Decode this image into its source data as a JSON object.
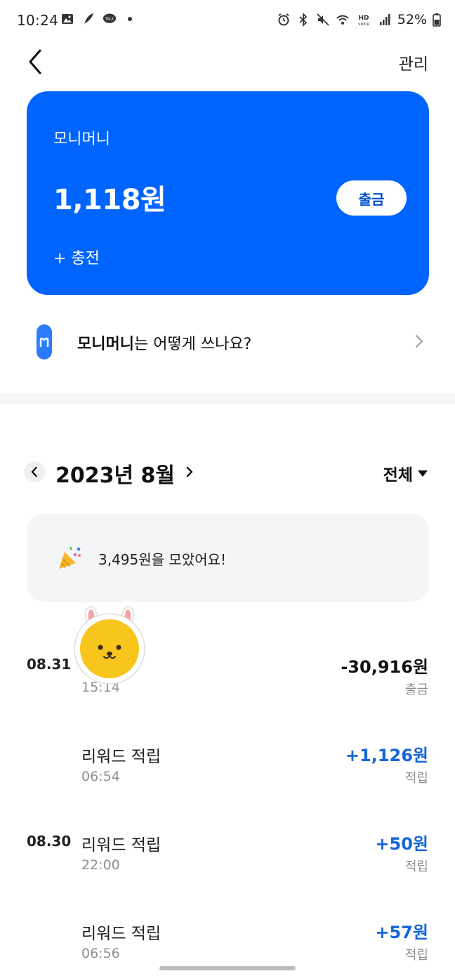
{
  "status_bar": {
    "time": "10:24",
    "battery": "52%"
  },
  "header": {
    "manage_label": "관리"
  },
  "wallet": {
    "name": "모니머니",
    "balance": "1,118원",
    "withdraw_label": "출금",
    "charge_label": "+ 충전",
    "accent_color": "#0064ff"
  },
  "guide": {
    "bold_part": "모니머니",
    "rest": "는 어떻게 쓰나요?"
  },
  "month_nav": {
    "title": "2023년 8월",
    "filter_label": "전체"
  },
  "summary": {
    "text": "3,495원을 모았어요!"
  },
  "transactions": [
    {
      "date": "08.31",
      "title": "",
      "time": "15:14",
      "amount": "-30,916원",
      "type": "출금",
      "positive": false
    },
    {
      "date": "",
      "title": "리워드 적립",
      "time": "06:54",
      "amount": "+1,126원",
      "type": "적립",
      "positive": true
    },
    {
      "date": "08.30",
      "title": "리워드 적립",
      "time": "22:00",
      "amount": "+50원",
      "type": "적립",
      "positive": true
    },
    {
      "date": "",
      "title": "리워드 적립",
      "time": "06:56",
      "amount": "+57원",
      "type": "적립",
      "positive": true
    }
  ]
}
